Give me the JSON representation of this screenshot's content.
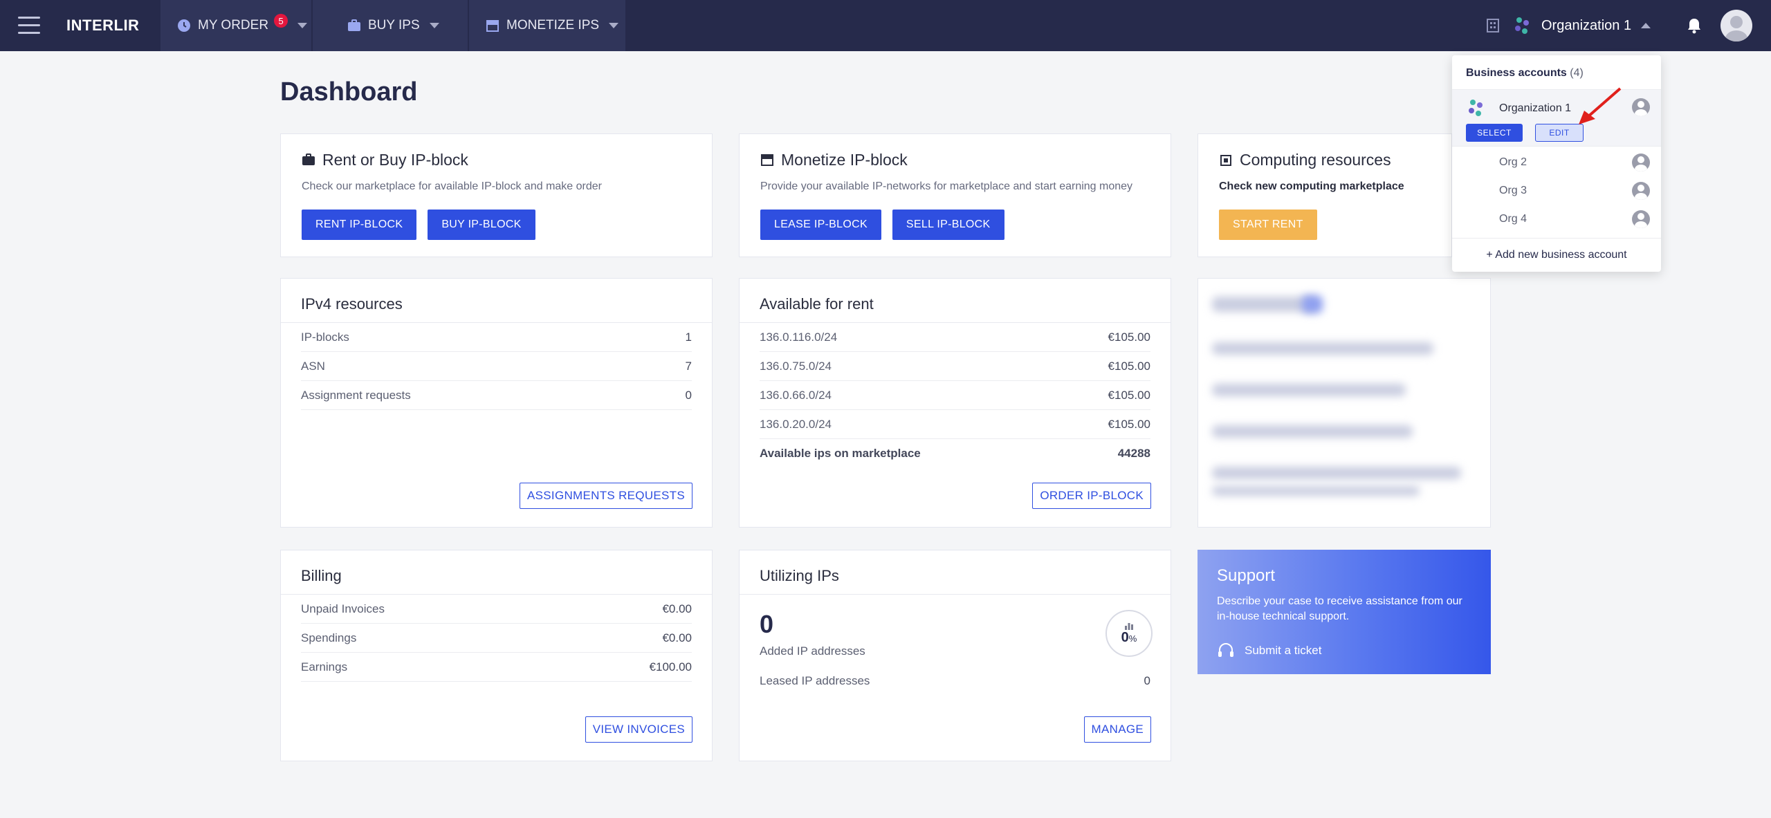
{
  "topbar": {
    "brand": "INTERLIR",
    "nav": [
      {
        "label": "MY ORDER",
        "badge": "5"
      },
      {
        "label": "BUY IPS"
      },
      {
        "label": "MONETIZE IPS"
      }
    ],
    "org_name": "Organization 1"
  },
  "page": {
    "title": "Dashboard"
  },
  "rent_card": {
    "title": "Rent or Buy IP-block",
    "subtitle": "Check our marketplace for available IP-block and make order",
    "btn1": "RENT IP-BLOCK",
    "btn2": "BUY IP-BLOCK"
  },
  "monetize_card": {
    "title": "Monetize IP-block",
    "subtitle": "Provide your available IP-networks for marketplace and start earning money",
    "btn1": "LEASE IP-BLOCK",
    "btn2": "SELL IP-BLOCK"
  },
  "computing_card": {
    "title": "Computing resources",
    "subtitle": "Check new computing marketplace",
    "btn1": "START RENT"
  },
  "ipv4": {
    "title": "IPv4 resources",
    "rows": [
      {
        "label": "IP-blocks",
        "value": "1"
      },
      {
        "label": "ASN",
        "value": "7"
      },
      {
        "label": "Assignment requests",
        "value": "0"
      }
    ],
    "button": "ASSIGNMENTS REQUESTS"
  },
  "rent": {
    "title": "Available for rent",
    "rows": [
      {
        "label": "136.0.116.0/24",
        "value": "€105.00"
      },
      {
        "label": "136.0.75.0/24",
        "value": "€105.00"
      },
      {
        "label": "136.0.66.0/24",
        "value": "€105.00"
      },
      {
        "label": "136.0.20.0/24",
        "value": "€105.00"
      }
    ],
    "total": {
      "label": "Available ips on marketplace",
      "value": "44288"
    },
    "button": "ORDER IP-BLOCK"
  },
  "billing": {
    "title": "Billing",
    "rows": [
      {
        "label": "Unpaid Invoices",
        "value": "€0.00"
      },
      {
        "label": "Spendings",
        "value": "€0.00"
      },
      {
        "label": "Earnings",
        "value": "€100.00"
      }
    ],
    "button": "VIEW INVOICES"
  },
  "utilizing": {
    "title": "Utilizing IPs",
    "count": "0",
    "count_label": "Added IP addresses",
    "percent": "0",
    "percent_sign": "%",
    "leased_label": "Leased IP addresses",
    "leased_value": "0",
    "button": "MANAGE"
  },
  "support": {
    "title": "Support",
    "text": "Describe your case to receive assistance from our in-house technical support.",
    "ticket": "Submit a ticket"
  },
  "dropdown": {
    "title": "Business accounts",
    "count": "(4)",
    "active": "Organization 1",
    "select": "SELECT",
    "edit": "EDIT",
    "orgs": [
      "Org 2",
      "Org 3",
      "Org 4"
    ],
    "add": "+ Add new business account"
  },
  "colors": {
    "topbar": "#262a4b",
    "primary": "#2f4fe0",
    "orange": "#f3b552",
    "badge": "#e3173e"
  }
}
